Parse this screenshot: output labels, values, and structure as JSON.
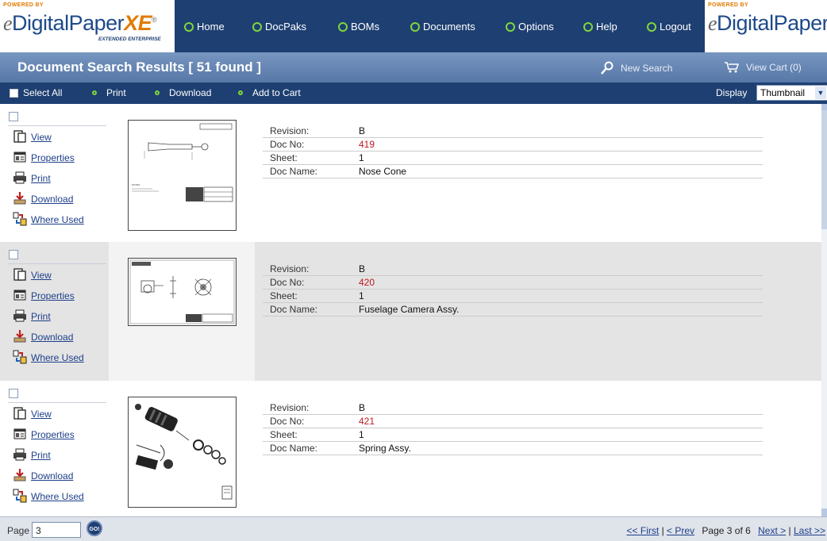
{
  "nav": {
    "powered_by": "POWERED BY",
    "brand_e": "e",
    "brand_text": "DigitalPaper",
    "brand_xe": "XE",
    "brand_reg": "®",
    "extended": "EXTENDED ENTERPRISE",
    "items": [
      {
        "label": "Home"
      },
      {
        "label": "DocPaks"
      },
      {
        "label": "BOMs"
      },
      {
        "label": "Documents"
      },
      {
        "label": "Options"
      },
      {
        "label": "Help"
      },
      {
        "label": "Logout"
      }
    ],
    "accent_color": "#7fd63c",
    "bar_color": "#1e3f72"
  },
  "titlebar": {
    "title": "Document Search Results [ 51 found ]",
    "new_search": "New Search",
    "view_cart": "View Cart (0)"
  },
  "actionbar": {
    "select_all": "Select All",
    "print": "Print",
    "download": "Download",
    "add_to_cart": "Add to Cart",
    "display_label": "Display",
    "display_value": "Thumbnail"
  },
  "row_actions": {
    "view": "View",
    "properties": "Properties",
    "print": "Print",
    "download": "Download",
    "where_used": "Where Used"
  },
  "field_labels": {
    "revision": "Revision:",
    "doc_no": "Doc No:",
    "sheet": "Sheet:",
    "doc_name": "Doc Name:"
  },
  "results": [
    {
      "revision": "B",
      "doc_no": "419",
      "sheet": "1",
      "doc_name": "Nose Cone"
    },
    {
      "revision": "B",
      "doc_no": "420",
      "sheet": "1",
      "doc_name": "Fuselage Camera Assy."
    },
    {
      "revision": "B",
      "doc_no": "421",
      "sheet": "1",
      "doc_name": "Spring Assy."
    }
  ],
  "footer": {
    "page_label": "Page",
    "page_input": "3",
    "go": "GO!",
    "first": "<< First",
    "prev": "< Prev",
    "page_status": "Page 3 of 6",
    "next": "Next >",
    "last": "Last >>",
    "sep": "|"
  }
}
